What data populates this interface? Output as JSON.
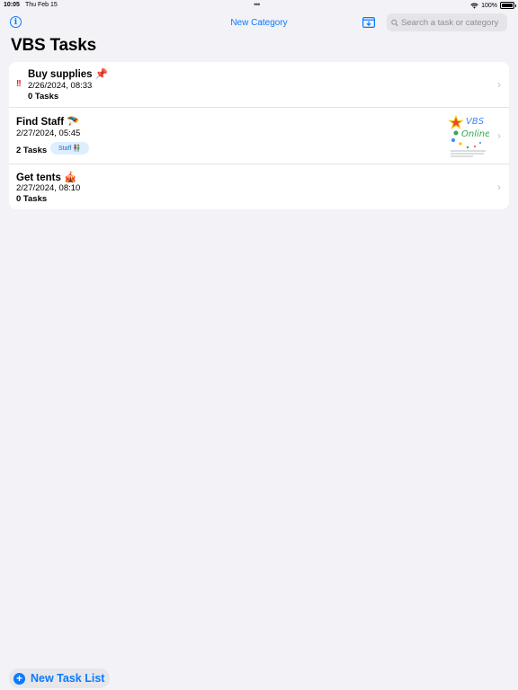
{
  "status_bar": {
    "time": "10:05",
    "date": "Thu Feb 15",
    "battery": "100%"
  },
  "nav": {
    "new_category_label": "New Category",
    "search_placeholder": "Search a task or category"
  },
  "page_title": "VBS Tasks",
  "task_lists": [
    {
      "name": "Buy supplies 📌",
      "date": "2/26/2024, 08:33",
      "count": "0 Tasks",
      "priority": "!!"
    },
    {
      "name": "Find Staff 🪂",
      "date": "2/27/2024, 05:45",
      "count": "2 Tasks",
      "tag": "Staff 👫",
      "thumbnail_text": "VBS Online"
    },
    {
      "name": "Get tents 🎪",
      "date": "2/27/2024, 08:10",
      "count": "0 Tasks"
    }
  ],
  "footer": {
    "new_task_list_label": "New Task List"
  },
  "colors": {
    "accent": "#0a7aff",
    "priority": "#e0242b",
    "tag_bg": "#ddeefe",
    "background": "#f2f2f7"
  },
  "icons": [
    "info-icon",
    "tray-download-icon",
    "search-icon",
    "chevron-right-icon",
    "plus-circle-icon",
    "wifi-icon",
    "battery-icon"
  ]
}
